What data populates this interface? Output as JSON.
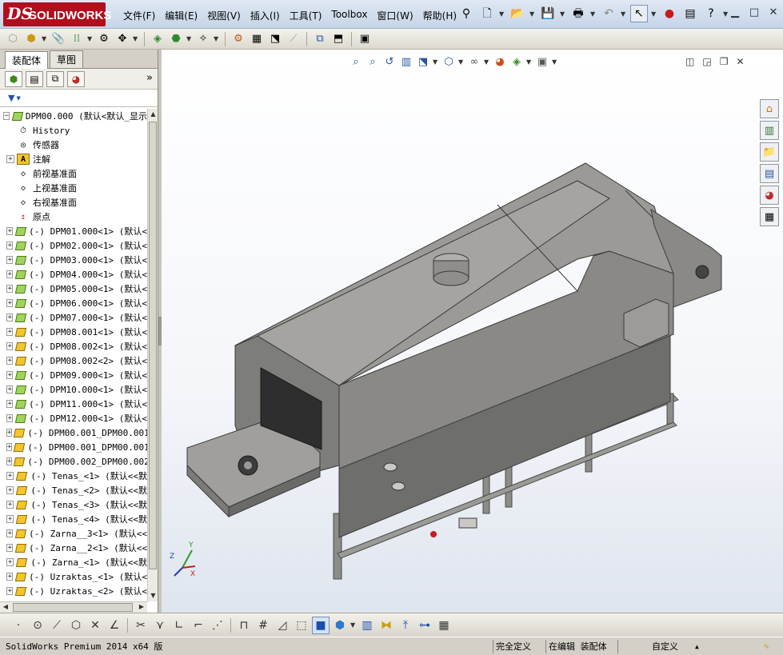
{
  "app": {
    "logo_ds": "DS",
    "logo_name": "SOLIDWORKS",
    "accent": "#b10f1d"
  },
  "menu": [
    "文件(F)",
    "编辑(E)",
    "视图(V)",
    "插入(I)",
    "工具(T)",
    "Toolbox",
    "窗口(W)",
    "帮助(H)"
  ],
  "feature_manager": {
    "tabs": [
      "装配体",
      "草图"
    ],
    "active_tab": "装配体",
    "expand_more": "»",
    "filter_icon": "funnel-icon"
  },
  "tree": [
    {
      "label": "DPM00.000  (默认<默认_显示",
      "icon": "assembly-icon",
      "exp": "−"
    },
    {
      "label": "History",
      "icon": "history-icon",
      "exp": ""
    },
    {
      "label": "传感器",
      "icon": "sensor-icon",
      "exp": ""
    },
    {
      "label": "注解",
      "icon": "annotation-icon",
      "exp": "+"
    },
    {
      "label": "前视基准面",
      "icon": "plane-icon",
      "exp": ""
    },
    {
      "label": "上视基准面",
      "icon": "plane-icon",
      "exp": ""
    },
    {
      "label": "右视基准面",
      "icon": "plane-icon",
      "exp": ""
    },
    {
      "label": "原点",
      "icon": "origin-icon",
      "exp": ""
    },
    {
      "label": "(-) DPM01.000<1> (默认<",
      "icon": "subassembly-icon",
      "exp": "+"
    },
    {
      "label": "(-) DPM02.000<1> (默认<",
      "icon": "subassembly-icon",
      "exp": "+"
    },
    {
      "label": "(-) DPM03.000<1> (默认<",
      "icon": "subassembly-icon",
      "exp": "+"
    },
    {
      "label": "(-) DPM04.000<1> (默认<",
      "icon": "subassembly-icon",
      "exp": "+"
    },
    {
      "label": "(-) DPM05.000<1> (默认<",
      "icon": "subassembly-icon",
      "exp": "+"
    },
    {
      "label": "(-) DPM06.000<1> (默认<",
      "icon": "subassembly-icon",
      "exp": "+"
    },
    {
      "label": "(-) DPM07.000<1> (默认<",
      "icon": "subassembly-icon",
      "exp": "+"
    },
    {
      "label": "(-) DPM08.001<1> (默认<",
      "icon": "part-icon",
      "exp": "+"
    },
    {
      "label": "(-) DPM08.002<1> (默认<",
      "icon": "part-icon",
      "exp": "+"
    },
    {
      "label": "(-) DPM08.002<2> (默认<",
      "icon": "part-icon",
      "exp": "+"
    },
    {
      "label": "(-) DPM09.000<1> (默认<",
      "icon": "subassembly-icon",
      "exp": "+"
    },
    {
      "label": "(-) DPM10.000<1> (默认<",
      "icon": "subassembly-icon",
      "exp": "+"
    },
    {
      "label": "(-) DPM11.000<1> (默认<",
      "icon": "subassembly-icon",
      "exp": "+"
    },
    {
      "label": "(-) DPM12.000<1> (默认<",
      "icon": "subassembly-icon",
      "exp": "+"
    },
    {
      "label": "(-) DPM00.001_DPM00.001",
      "icon": "part-icon",
      "exp": "+"
    },
    {
      "label": "(-) DPM00.001_DPM00.001",
      "icon": "part-icon",
      "exp": "+"
    },
    {
      "label": "(-) DPM00.002_DPM00.002",
      "icon": "part-icon",
      "exp": "+"
    },
    {
      "label": "(-) Tenas_<1> (默认<<默",
      "icon": "part-icon",
      "exp": "+"
    },
    {
      "label": "(-) Tenas_<2> (默认<<默",
      "icon": "part-icon",
      "exp": "+"
    },
    {
      "label": "(-) Tenas_<3> (默认<<默",
      "icon": "part-icon",
      "exp": "+"
    },
    {
      "label": "(-) Tenas_<4> (默认<<默",
      "icon": "part-icon",
      "exp": "+"
    },
    {
      "label": "(-) Zarna__3<1> (默认<<",
      "icon": "part-icon",
      "exp": "+"
    },
    {
      "label": "(-) Zarna__2<1> (默认<<",
      "icon": "part-icon",
      "exp": "+"
    },
    {
      "label": "(-) Zarna_<1> (默认<<默",
      "icon": "part-icon",
      "exp": "+"
    },
    {
      "label": "(-) Uzraktas_<1> (默认<",
      "icon": "part-icon",
      "exp": "+"
    },
    {
      "label": "(-) Uzraktas_<2> (默认<",
      "icon": "part-icon",
      "exp": "+"
    }
  ],
  "triad": {
    "x": "X",
    "y": "Y",
    "z": "Z"
  },
  "status": {
    "version": "SolidWorks Premium 2014 x64 版",
    "constraint": "完全定义",
    "mode": "在编辑 装配体",
    "units": "自定义",
    "units_caret": "▲"
  }
}
